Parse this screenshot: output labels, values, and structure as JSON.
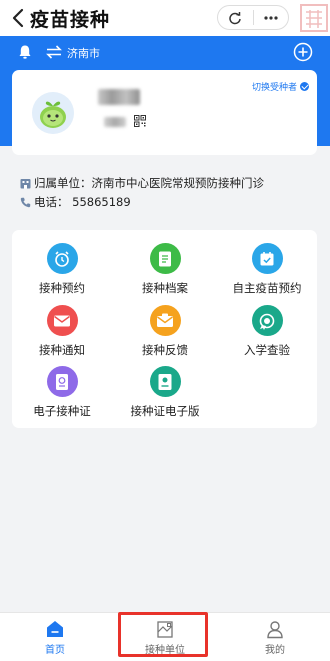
{
  "navbar": {
    "title": "疫苗接种",
    "back_icon": "chevron-left-icon",
    "capsule_icons": [
      "refresh-icon",
      "more-icon"
    ]
  },
  "header": {
    "city": "济南市",
    "bell_icon": "bell-icon",
    "swap_icon": "swap-icon",
    "add_icon": "plus-circle-icon",
    "color": "#1e78f0"
  },
  "profile": {
    "switch_label": "切换受种者",
    "avatar_icon": "baby-avatar-icon",
    "qr_icon": "qr-code-icon"
  },
  "unit": {
    "belong_label": "归属单位：济南市中心医院常规预防接种门诊",
    "phone_label": "电话：  55865189"
  },
  "menu": [
    {
      "label": "接种预约",
      "icon": "alarm-clock-icon",
      "color": "#2aa6e8"
    },
    {
      "label": "接种档案",
      "icon": "document-icon",
      "color": "#3dbb47"
    },
    {
      "label": "自主疫苗预约",
      "icon": "calendar-check-icon",
      "color": "#2aa6e8"
    },
    {
      "label": "接种通知",
      "icon": "envelope-icon",
      "color": "#ef4f4f"
    },
    {
      "label": "接种反馈",
      "icon": "feedback-mail-icon",
      "color": "#f5a21e"
    },
    {
      "label": "入学查验",
      "icon": "certificate-check-icon",
      "color": "#1aa88a"
    },
    {
      "label": "电子接种证",
      "icon": "passport-icon",
      "color": "#8e6ae8"
    },
    {
      "label": "接种证电子版",
      "icon": "card-icon",
      "color": "#1aa88a"
    }
  ],
  "tabs": [
    {
      "label": "首页",
      "icon": "home-icon",
      "active": true
    },
    {
      "label": "接种单位",
      "icon": "building-icon",
      "active": false
    },
    {
      "label": "我的",
      "icon": "user-icon",
      "active": false
    }
  ]
}
